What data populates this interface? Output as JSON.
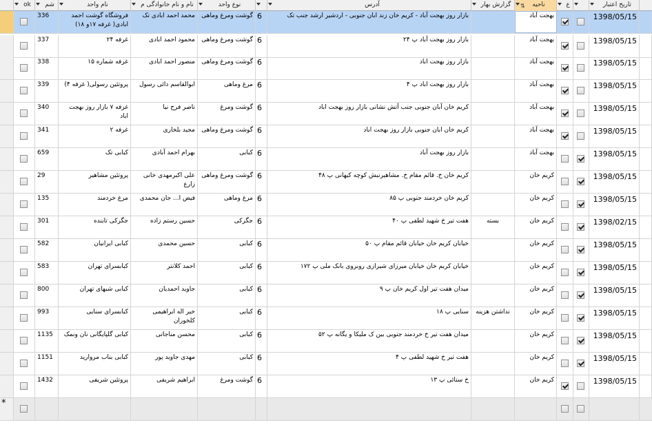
{
  "columns": [
    {
      "key": "ok",
      "label": "ok"
    },
    {
      "key": "shomare",
      "label": "شم"
    },
    {
      "key": "name",
      "label": "نام واحد"
    },
    {
      "key": "owner",
      "label": "نام و نام خانوادگی م"
    },
    {
      "key": "type",
      "label": "نوع واحد"
    },
    {
      "key": "typecode",
      "label": ""
    },
    {
      "key": "address",
      "label": "آدرس"
    },
    {
      "key": "report",
      "label": "گزارش بهار"
    },
    {
      "key": "region",
      "label": "ناحیه"
    },
    {
      "key": "c1",
      "label": "ع"
    },
    {
      "key": "c2",
      "label": ""
    },
    {
      "key": "date",
      "label": "تاریخ اعتبار"
    }
  ],
  "colors": {
    "header": "#f0f0f0",
    "selected_header": "#f9d99f",
    "current_row": "#b8d4f5",
    "grid_line": "#d4d4d4"
  },
  "rows": [
    {
      "id": "336",
      "name": "فروشگاه گوشت احمد ابادی( غرفه ۱۷و ۱۸)",
      "owner": "محمد احمد ابادی تک",
      "type": "گوشت ومرغ وماهی",
      "code": "6",
      "address": "بازار روز بهجت آباد - کریم خان زند ابان جنوبی - اردشیر ارشد جنب تک",
      "report": "",
      "region": "بهجت آباد",
      "c1": true,
      "c2": false,
      "date": "1398/05/15",
      "ok": false
    },
    {
      "id": "337",
      "name": "غرفه ۲۴",
      "owner": "محمود احمد ابادی",
      "type": "گوشت ومرغ وماهی",
      "code": "6",
      "address": "بازار روز بهجت آباد  پ ۲۴",
      "report": "",
      "region": "بهجت آباد",
      "c1": true,
      "c2": false,
      "date": "1398/05/15",
      "ok": false
    },
    {
      "id": "338",
      "name": "غرفه شماره ۱۵",
      "owner": "منصور احمد ابادی",
      "type": "گوشت ومرغ وماهی",
      "code": "6",
      "address": "بازار روز بهجت اباد",
      "report": "",
      "region": "بهجت آباد",
      "c1": true,
      "c2": false,
      "date": "1398/05/15",
      "ok": false
    },
    {
      "id": "339",
      "name": "پروتئین رسولی( غرفه ۴)",
      "owner": "ابوالقاسم دائی رسول",
      "type": "مرغ وماهی",
      "code": "6",
      "address": "بازار روز بهجت اباد پ ۴",
      "report": "",
      "region": "بهجت آباد",
      "c1": true,
      "c2": false,
      "date": "1398/05/15",
      "ok": false
    },
    {
      "id": "340",
      "name": "غرفه ۷ بازار روز بهجت اباد",
      "owner": "ناصر فرح نیا",
      "type": "گوشت ومرغ",
      "code": "6",
      "address": "کریم خان آبان جنوبی جنب آتش نشانی بازار روز بهجت اباد",
      "report": "",
      "region": "بهجت آباد",
      "c1": true,
      "c2": false,
      "date": "1398/05/15",
      "ok": false
    },
    {
      "id": "341",
      "name": "غرفه ۲",
      "owner": "مجید بلخاری",
      "type": "گوشت ومرغ وماهی",
      "code": "6",
      "address": "کریم خان ابان جنوبی بازار روز بهجت اباد",
      "report": "",
      "region": "بهجت آباد",
      "c1": true,
      "c2": false,
      "date": "1398/05/15",
      "ok": false
    },
    {
      "id": "659",
      "name": "کبابی تک",
      "owner": "بهرام احمد آبادی",
      "type": "کبابی",
      "code": "6",
      "address": "بازار روز بهجت آباد",
      "report": "",
      "region": "بهجت آباد",
      "c1": false,
      "c2": true,
      "date": "1398/05/15",
      "ok": false
    },
    {
      "id": "29",
      "name": "پروتئین مشاهیر",
      "owner": "علی اکبرمهدی خانی زارع",
      "type": "گوشت ومرغ وماهی",
      "code": "6",
      "address": "کریم خان خ. قائم مقام خ. مشاهیرنبش کوچه کیهانی پ ۴۸",
      "report": "",
      "region": "کریم خان",
      "c1": false,
      "c2": true,
      "date": "1398/05/15",
      "ok": false
    },
    {
      "id": "135",
      "name": "مرغ خردمند",
      "owner": "فیض ا... جان محمدی",
      "type": "مرغ وماهی",
      "code": "6",
      "address": "کریم خان خردمند جنوبی پ ۸۵",
      "report": "",
      "region": "کریم خان",
      "c1": false,
      "c2": true,
      "date": "1398/05/15",
      "ok": false
    },
    {
      "id": "301",
      "name": "جگرکی تابنده",
      "owner": "حسین رستم زاده",
      "type": "جگرکی",
      "code": "6",
      "address": "هفت تیر خ شهید لطفی پ ۴۰",
      "report": "بسته",
      "region": "کریم خان",
      "c1": false,
      "c2": true,
      "date": "1398/02/15",
      "ok": false
    },
    {
      "id": "582",
      "name": "کبابی ایرانیان",
      "owner": "حسین محمدی",
      "type": "کبابی",
      "code": "6",
      "address": "خیابان کریم خان خیابان قائم مقام پ ۵۰",
      "report": "",
      "region": "کریم خان",
      "c1": false,
      "c2": true,
      "date": "1398/05/15",
      "ok": false
    },
    {
      "id": "583",
      "name": "کبابسرای تهران",
      "owner": "احمد کلانتر",
      "type": "کبابی",
      "code": "6",
      "address": "خیابان کریم خان خیابان میرزای شیرازی روبروی بانک ملی پ ۱۷۲",
      "report": "",
      "region": "کریم خان",
      "c1": false,
      "c2": true,
      "date": "1398/05/15",
      "ok": false
    },
    {
      "id": "800",
      "name": "کبابی شبهای تهران",
      "owner": "جاوید احمدیان",
      "type": "کبابی",
      "code": "6",
      "address": "میدان هفت تیر اول کریم خان پ ۹",
      "report": "",
      "region": "کریم خان",
      "c1": false,
      "c2": true,
      "date": "1398/05/15",
      "ok": false
    },
    {
      "id": "993",
      "name": "کبابسرای سنایی",
      "owner": "خیر اله ابراهیمی کلخوران",
      "type": "کبابی",
      "code": "6",
      "address": "سنایی پ ۱۸",
      "report": "نداشتن هزینه",
      "region": "کریم خان",
      "c1": false,
      "c2": true,
      "date": "1398/05/15",
      "ok": false
    },
    {
      "id": "1135",
      "name": "کبابی گلپایگانی نان ونمک",
      "owner": "محسن مناجاتی",
      "type": "کبابی",
      "code": "6",
      "address": "میدان هفت تیر خ خردمند جنوبی بین ک ملیکا و یگانه پ ۵۲",
      "report": "",
      "region": "کریم خان",
      "c1": false,
      "c2": true,
      "date": "1398/05/15",
      "ok": false
    },
    {
      "id": "1151",
      "name": "کبابی بناب مروارید",
      "owner": "مهدی جاوید پور",
      "type": "کبابی",
      "code": "6",
      "address": "هفت تیر خ شهید لطفی پ ۴",
      "report": "",
      "region": "کریم خان",
      "c1": false,
      "c2": true,
      "date": "1398/05/15",
      "ok": false
    },
    {
      "id": "1432",
      "name": "پروتئین شریفی",
      "owner": "ابراهیم شریفی",
      "type": "گوشت ومرغ",
      "code": "6",
      "address": "خ سنائی پ ۱۳",
      "report": "",
      "region": "کریم خان",
      "c1": true,
      "c2": false,
      "date": "1398/05/15",
      "ok": false
    }
  ],
  "new_row_marker": "*"
}
